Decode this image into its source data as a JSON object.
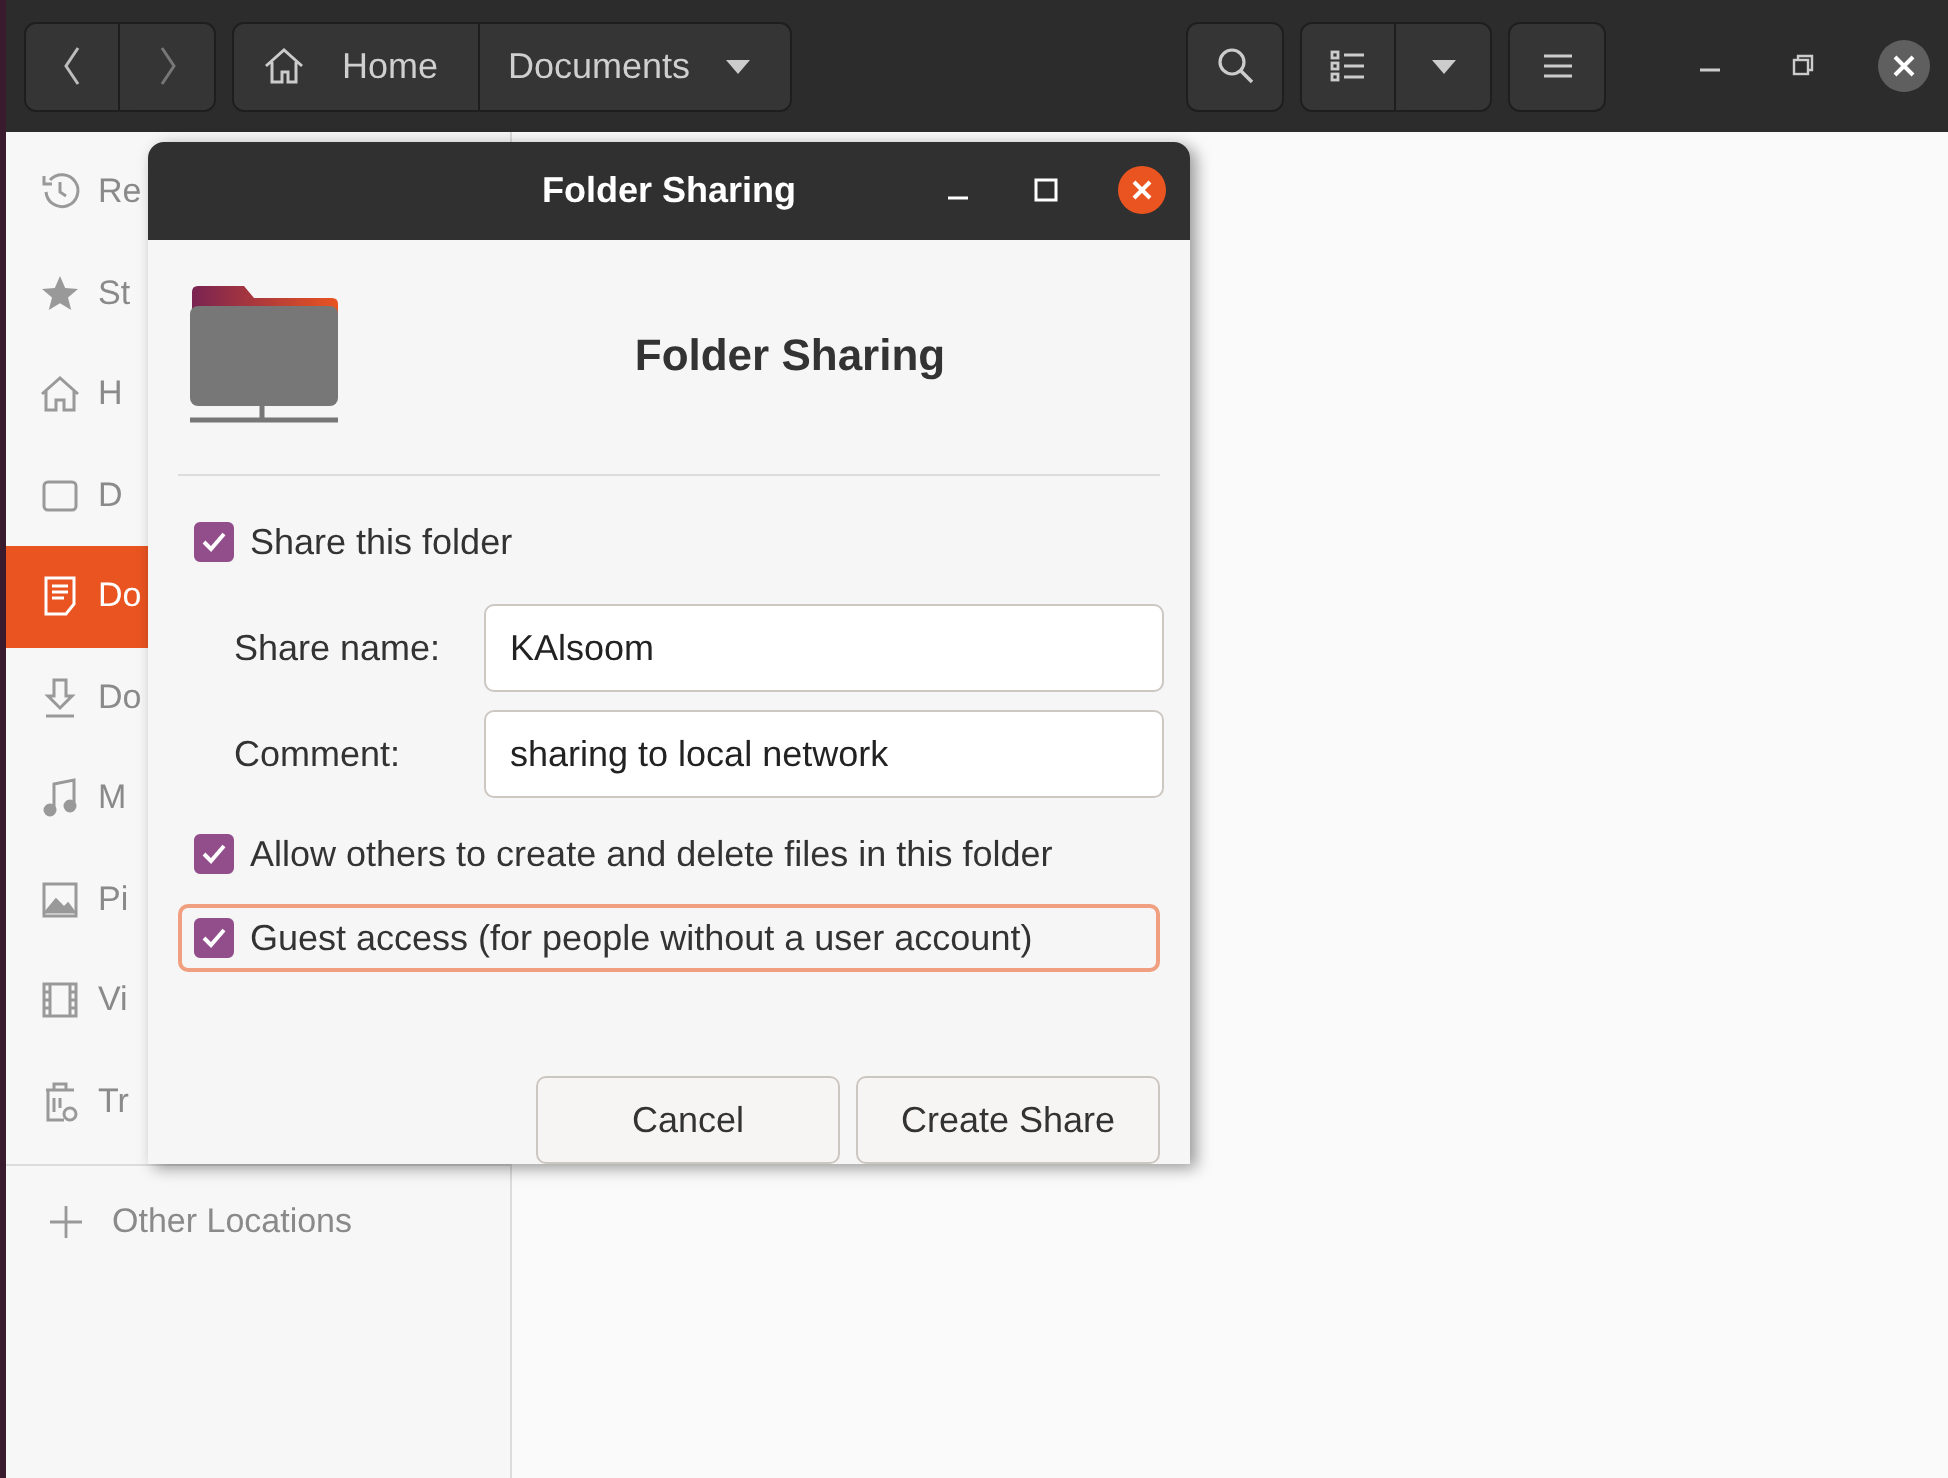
{
  "header": {
    "path": [
      {
        "label": "Home",
        "kind": "home"
      },
      {
        "label": "Documents",
        "kind": "menu"
      }
    ]
  },
  "sidebar": {
    "items": [
      {
        "label": "Re",
        "selected": false
      },
      {
        "label": "St",
        "selected": false
      },
      {
        "label": "H",
        "selected": false
      },
      {
        "label": "D",
        "selected": false
      },
      {
        "label": "Do",
        "selected": true
      },
      {
        "label": "Do",
        "selected": false
      },
      {
        "label": "M",
        "selected": false
      },
      {
        "label": "Pi",
        "selected": false
      },
      {
        "label": "Vi",
        "selected": false
      },
      {
        "label": "Tr",
        "selected": false
      }
    ],
    "other": "Other Locations"
  },
  "dialog": {
    "title": "Folder Sharing",
    "heading": "Folder Sharing",
    "share": {
      "label": "Share this folder",
      "checked": true
    },
    "fields": [
      {
        "label": "Share name:",
        "value": "KAlsoom"
      },
      {
        "label": "Comment:",
        "value": "sharing to local network"
      }
    ],
    "options": [
      {
        "label": "Allow others to create and delete files in this folder",
        "checked": true,
        "focused": false
      },
      {
        "label": "Guest access (for people without a user account)",
        "checked": true,
        "focused": true
      }
    ],
    "buttons": [
      "Cancel",
      "Create Share"
    ]
  }
}
